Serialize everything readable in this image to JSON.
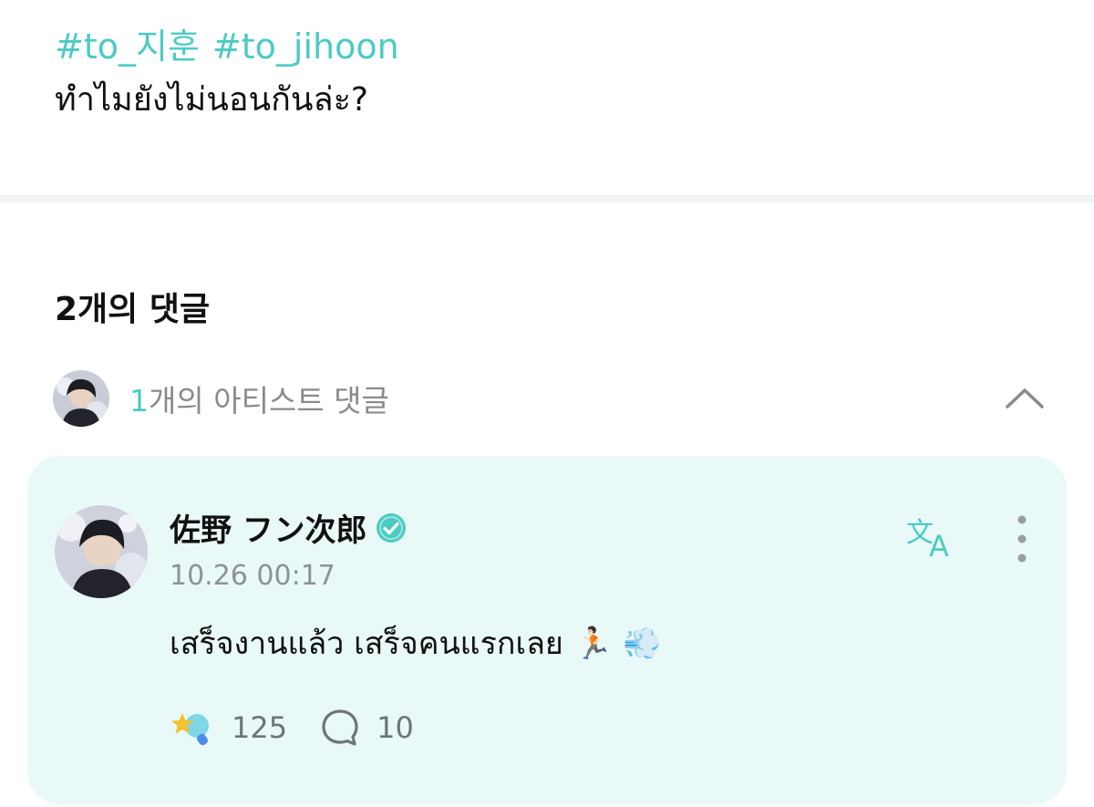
{
  "post": {
    "hashtags": [
      "#to_지훈",
      "#to_jihoon"
    ],
    "text": "ทำไมยังไม่นอนกันล่ะ?"
  },
  "comments": {
    "count_label": "2개의 댓글",
    "artist_section": {
      "count": "1",
      "label": "개의 아티스트 댓글"
    },
    "artist_comment": {
      "author": "佐野 フン次郎",
      "timestamp": "10.26 00:17",
      "text": "เสร็จงานแล้ว เสร็จคนแรกเลย",
      "emoji": "🏃🏻 💨",
      "likes": "125",
      "replies": "10"
    }
  },
  "colors": {
    "accent": "#4ccbc4",
    "card_background": "#e9f9f7",
    "muted_text": "#8d9295"
  },
  "icons": [
    "collapse-chevron-up-icon",
    "verified-badge-icon",
    "translate-icon",
    "more-vertical-icon",
    "cheer-star-icon",
    "comment-bubble-icon"
  ]
}
